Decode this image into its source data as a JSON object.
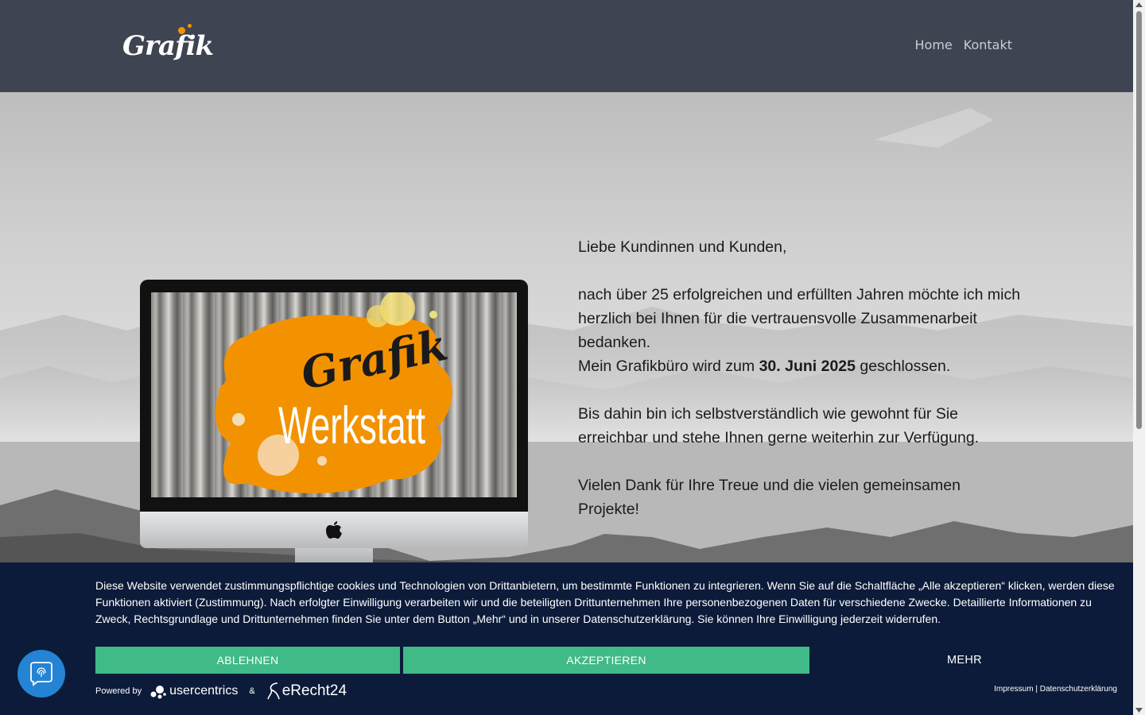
{
  "header": {
    "logo_text": "Grafik",
    "nav": [
      {
        "label": "Home"
      },
      {
        "label": "Kontakt"
      }
    ]
  },
  "hero": {
    "screen_title": "Grafik",
    "screen_subtitle": "Werkstatt",
    "greeting": "Liebe Kundinnen und Kunden,",
    "para1": "nach über 25 erfolgreichen und erfüllten Jahren möchte ich mich herzlich bei Ihnen für die vertrauensvolle Zusammenarbeit bedanken.",
    "para2_prefix": "Mein Grafikbüro wird zum ",
    "para2_bold": "30. Juni 2025",
    "para2_suffix": " geschlossen.",
    "para3": "Bis dahin bin ich selbstverständlich wie gewohnt für Sie erreichbar und stehe Ihnen gerne weiterhin zur Verfügung.",
    "para4": "Vielen Dank für Ihre Treue und die vielen gemeinsamen Projekte!"
  },
  "cookie": {
    "text": "Diese Website verwendet zustimmungspflichtige cookies und Technologien von Drittanbietern, um bestimmte Funktionen zu integrieren. Wenn Sie auf die Schaltfläche „Alle akzeptieren“ klicken, werden diese Funktionen aktiviert (Zustimmung). Nach erfolgter Einwilligung verarbeiten wir und die beteiligten Drittunternehmen Ihre personenbezogenen Daten für verschiedene Zwecke. Detaillierte Informationen zu Zweck, Rechtsgrundlage und Drittunternehmen finden Sie unter dem Button „Mehr“ und in unserer Datenschutzerklärung. Sie können Ihre Einwilligung jederzeit widerrufen.",
    "decline_label": "ABLEHNEN",
    "accept_label": "AKZEPTIEREN",
    "more_label": "MEHR",
    "powered_by": "Powered by",
    "usercentrics": "usercentrics",
    "amp": "&",
    "erecht": "eRecht24",
    "impressum": "Impressum",
    "separator": " | ",
    "datenschutz": "Datenschutzerklärung"
  },
  "colors": {
    "header_bg": "#3f4452",
    "banner_bg": "#0c1b39",
    "button_green": "#40ba86",
    "accent_orange": "#f39200",
    "privacy_blue": "#2583d3"
  },
  "icons": [
    "apple-icon",
    "fingerprint-icon",
    "usercentrics-icon",
    "erecht24-icon"
  ]
}
